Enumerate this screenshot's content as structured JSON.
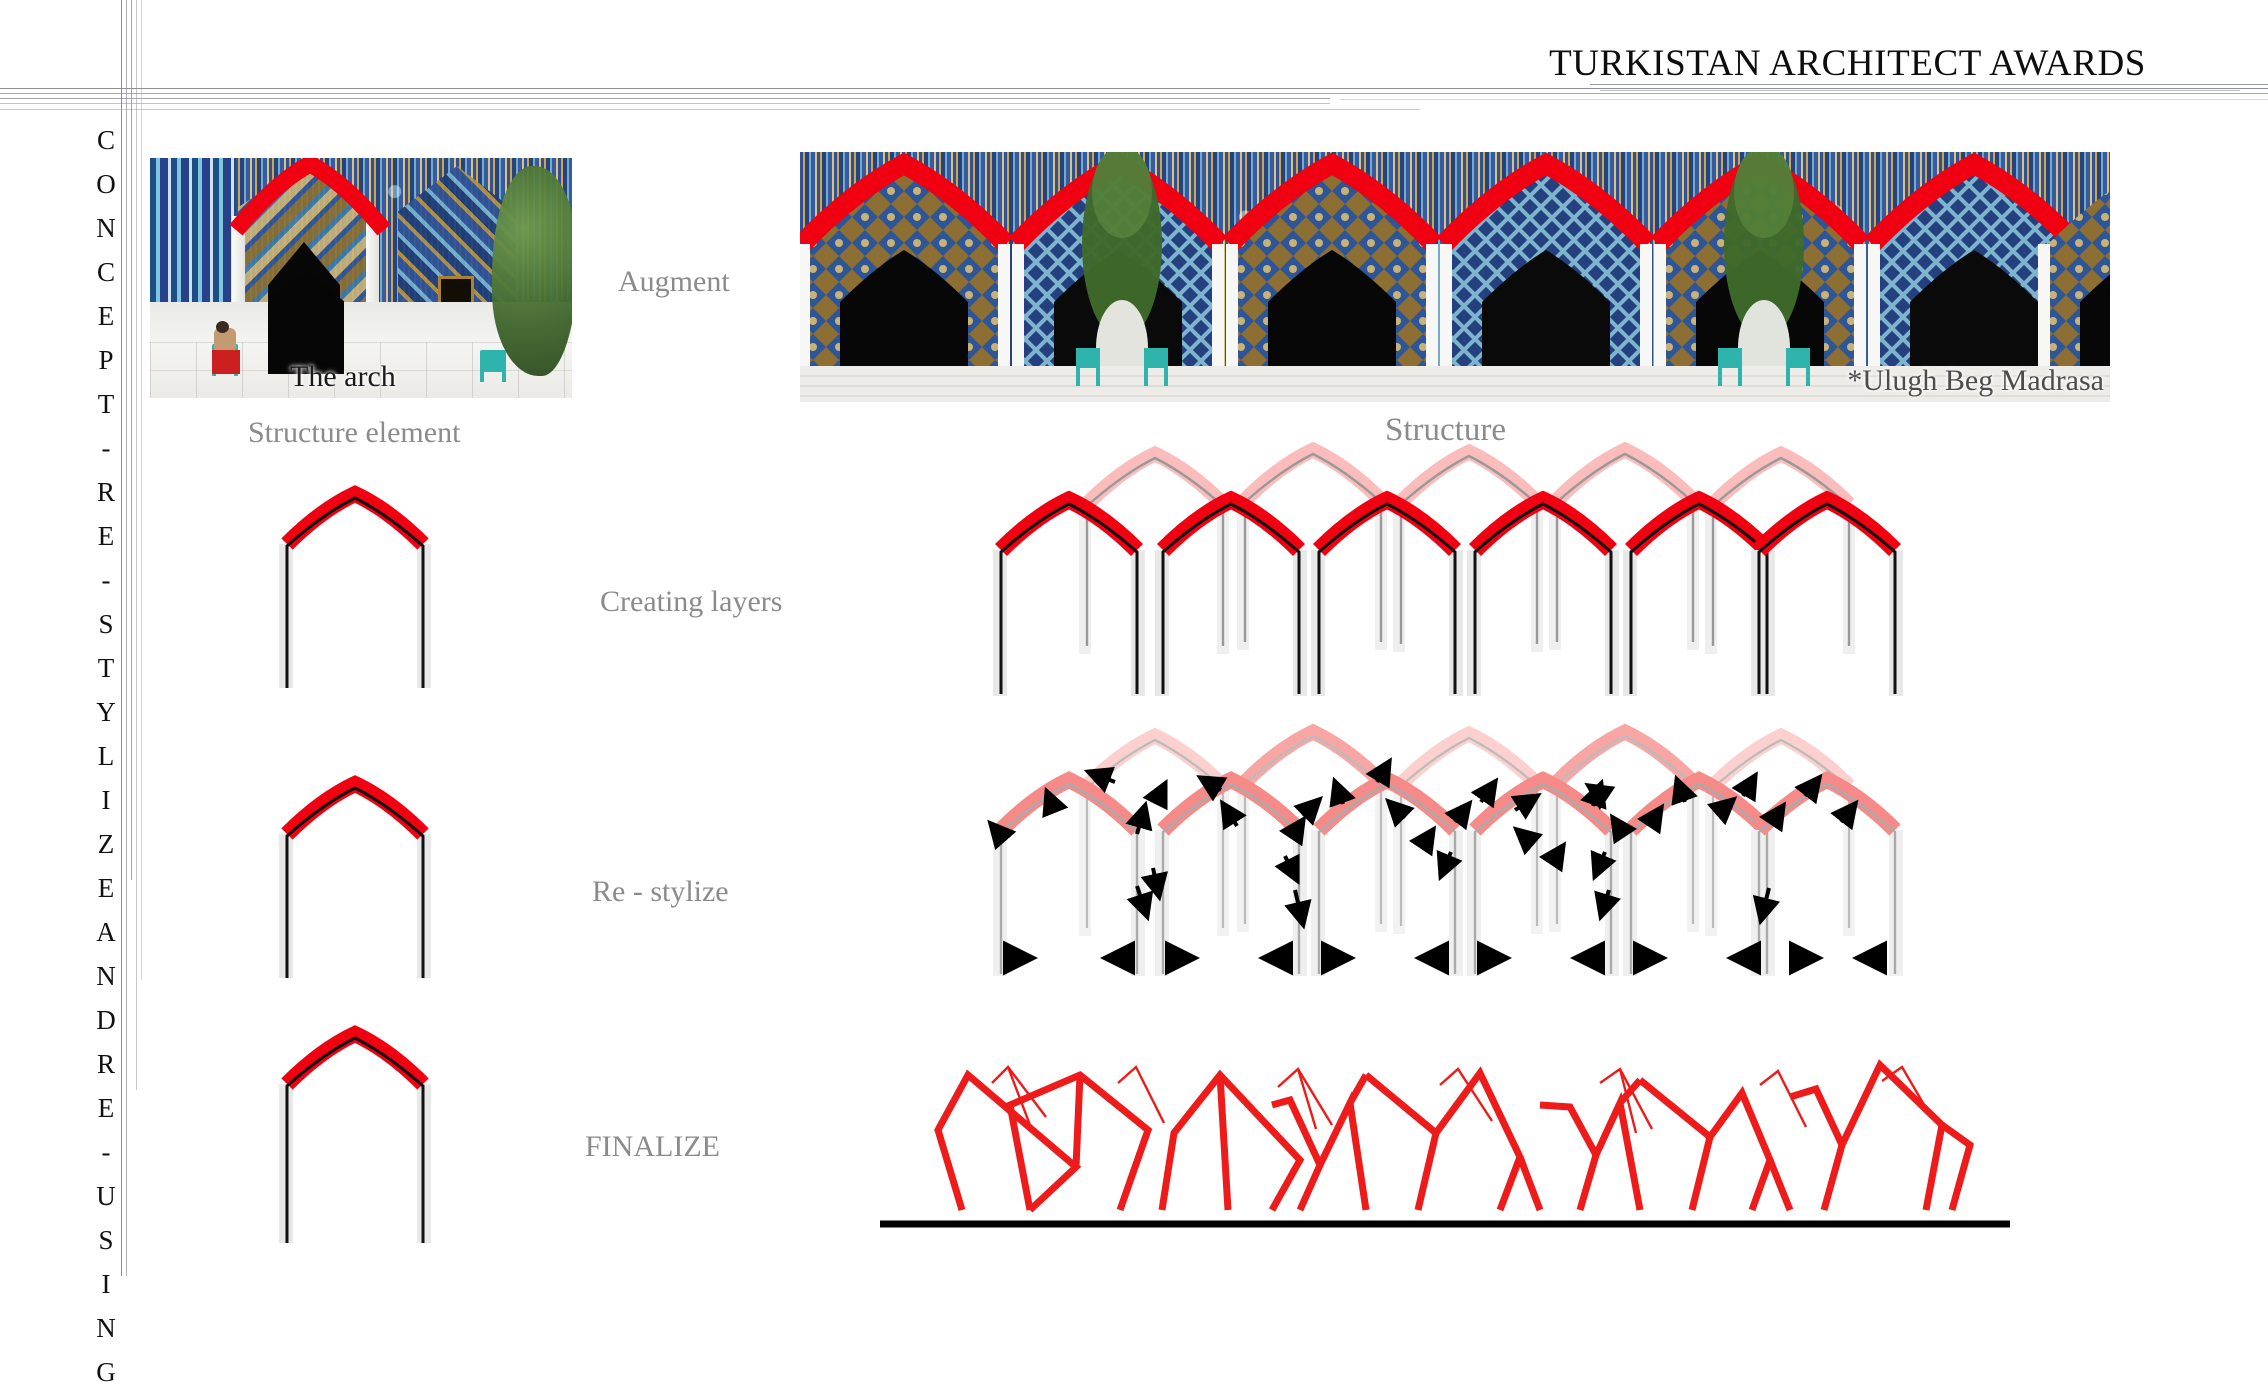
{
  "header": {
    "title": "TURKISTAN ARCHITECT AWARDS"
  },
  "side_caption": {
    "full_text": "CONCEPT - RE - STYLIZE AND RE - USING",
    "letters": [
      "C",
      "O",
      "N",
      "C",
      "E",
      "P",
      "T",
      "-",
      "R",
      "E",
      "-",
      "S",
      "T",
      "Y",
      "L",
      "I",
      "Z",
      "E",
      "A",
      "N",
      "D",
      "R",
      "E",
      "-",
      "U",
      "S",
      "I",
      "N",
      "G"
    ]
  },
  "photos": {
    "element_photo": {
      "overlay_caption": "The arch",
      "below_label": "Structure element"
    },
    "panorama_photo": {
      "credit_caption": "*Ulugh Beg Madrasa",
      "below_label": "Structure"
    }
  },
  "steps": [
    {
      "label": "Augment"
    },
    {
      "label": "Creating layers"
    },
    {
      "label": "Re - stylize"
    },
    {
      "label": "FINALIZE"
    }
  ],
  "colors": {
    "accent_red": "#f00010",
    "faded_red": "#f58a88",
    "ghost_red": "#fbbdbb",
    "label_gray": "#8b8b8b",
    "rule_gray": "#8d8f96",
    "ink_black": "#111111",
    "column_gray": "#e8e8e8",
    "tile_blue": "#2b4c92",
    "tile_gold": "#c9a24a",
    "chair_teal": "#2fb3ad"
  },
  "diagram": {
    "single_arch_count": 3,
    "layered_arch_front_count": 6,
    "layered_arch_back_count": 5,
    "restylize_arrow_count": 41,
    "finalize_ground_line": true
  }
}
